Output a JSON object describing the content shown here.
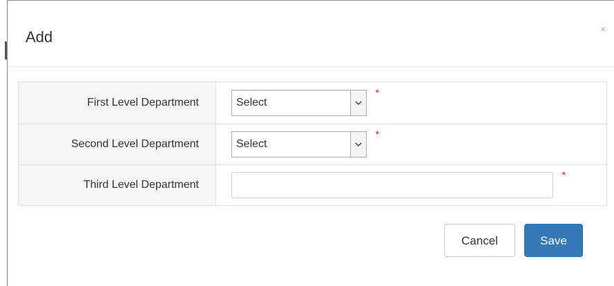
{
  "dialog": {
    "title": "Add",
    "close_glyph": "×"
  },
  "form": {
    "rows": [
      {
        "label": "First Level Department",
        "type": "select",
        "value": "Select",
        "required_mark": "*"
      },
      {
        "label": "Second Level Department",
        "type": "select",
        "value": "Select",
        "required_mark": "*"
      },
      {
        "label": "Third Level Department",
        "type": "text",
        "value": "",
        "required_mark": "*"
      }
    ]
  },
  "footer": {
    "cancel_label": "Cancel",
    "save_label": "Save"
  },
  "colors": {
    "primary": "#3478b7",
    "required": "#e02020",
    "label_bg": "#f5f5f5"
  },
  "icons": {
    "select_arrow": "chevron-down-icon",
    "close": "close-icon"
  }
}
